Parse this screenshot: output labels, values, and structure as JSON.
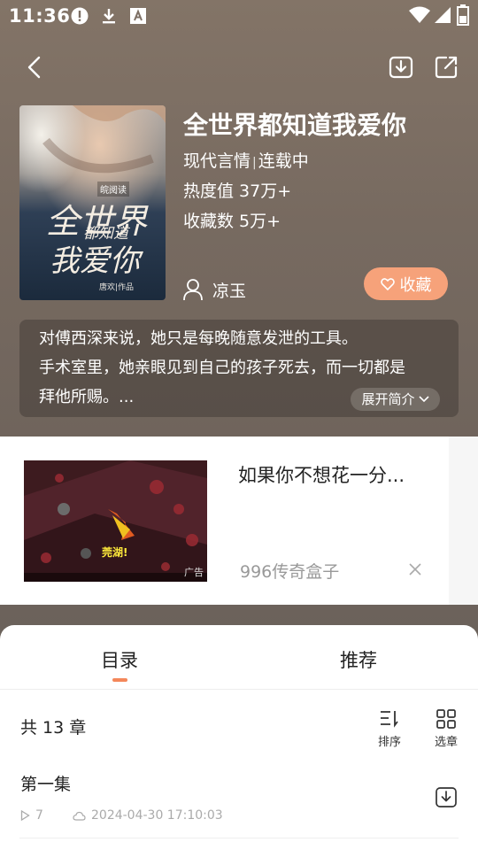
{
  "status_bar": {
    "time": "11:36",
    "icons": [
      "alert-icon",
      "download-icon",
      "font-icon",
      "wifi-icon",
      "signal-icon",
      "battery-icon"
    ]
  },
  "topbar": {
    "icons": [
      "back-icon",
      "download-icon",
      "share-icon"
    ]
  },
  "book": {
    "title": "全世界都知道我爱你",
    "category": "现代言情",
    "status": "连载中",
    "popularity": "热度值 37万+",
    "favorites": "收藏数 5万+",
    "author": "凉玉",
    "favorite_button": "收藏",
    "cover": {
      "publisher": "皖阅读",
      "title_line1": "全世界",
      "title_line2": "都知道",
      "title_line3": "我爱你",
      "author_line": "唐欢|作品"
    }
  },
  "synopsis": {
    "lines": [
      "对傅西深来说，她只是每晚随意发泄的工具。",
      "手术室里，她亲眼见到自己的孩子死去，而一切都是",
      "拜他所赐。..."
    ],
    "expand_label": "展开简介"
  },
  "ad": {
    "title": "如果你不想花一分...",
    "source": "996传奇盒子",
    "tag": "广告",
    "image_text": "莞湖!"
  },
  "tabs": [
    {
      "label": "目录",
      "active": true
    },
    {
      "label": "推荐",
      "active": false
    }
  ],
  "catalog": {
    "count": "共 13 章",
    "sort_label": "排序",
    "select_label": "选章",
    "chapters": [
      {
        "title": "第一集",
        "plays": "7",
        "updated": "2024-04-30 17:10:03"
      }
    ]
  },
  "colors": {
    "accent": "#f4875a",
    "fav_button": "#f6a27a",
    "hero_bg": "#776a60"
  }
}
